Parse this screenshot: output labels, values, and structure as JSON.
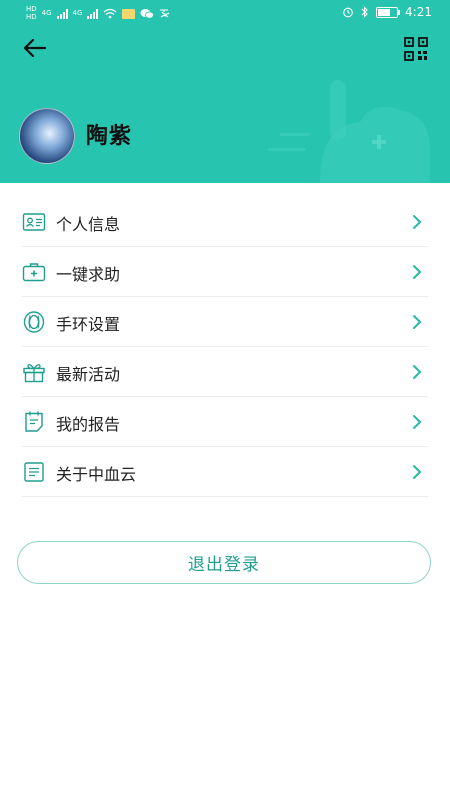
{
  "status_bar": {
    "left_badges": [
      "HD",
      "HD"
    ],
    "network_labels": [
      "4G",
      "4G"
    ],
    "time": "4:21"
  },
  "profile": {
    "name": "陶紫"
  },
  "menu": [
    {
      "label": "个人信息",
      "icon": "id-card-icon"
    },
    {
      "label": "一键求助",
      "icon": "first-aid-kit-icon"
    },
    {
      "label": "手环设置",
      "icon": "wristband-icon"
    },
    {
      "label": "最新活动",
      "icon": "gift-icon"
    },
    {
      "label": "我的报告",
      "icon": "report-icon"
    },
    {
      "label": "关于中血云",
      "icon": "document-icon"
    }
  ],
  "logout_label": "退出登录",
  "colors": {
    "header_bg": "#27c4b0",
    "accent": "#1f9e8e",
    "icon": "#1f9e8e",
    "chevron": "#27b8a6"
  }
}
